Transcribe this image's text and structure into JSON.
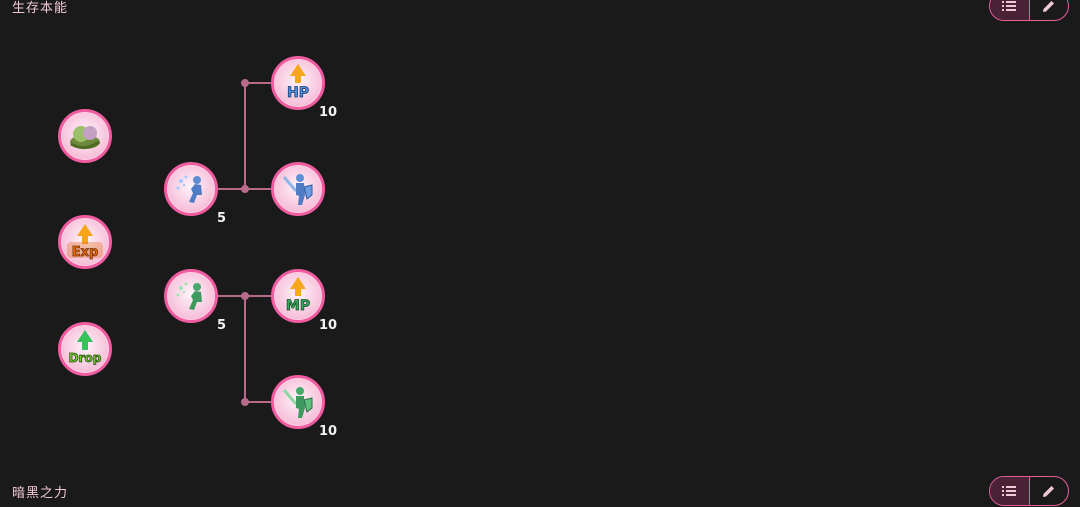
{
  "sections": [
    {
      "title": "生存本能"
    },
    {
      "title": "暗黑之力"
    }
  ],
  "toolbar": {
    "list_icon": "list-icon",
    "edit_icon": "pencil-icon"
  },
  "skills": {
    "clover": {
      "icon": "clover-icon"
    },
    "exp": {
      "icon": "exp-up-icon",
      "text": "Exp"
    },
    "drop": {
      "icon": "drop-up-icon",
      "text": "Drop"
    },
    "blue_rest": {
      "icon": "blue-rest-icon",
      "level": "5"
    },
    "hp_up": {
      "icon": "hp-up-icon",
      "text": "HP",
      "level": "10"
    },
    "blue_guard": {
      "icon": "blue-guard-icon"
    },
    "green_rest": {
      "icon": "green-rest-icon",
      "level": "5"
    },
    "mp_up": {
      "icon": "mp-up-icon",
      "text": "MP",
      "level": "10"
    },
    "green_guard": {
      "icon": "green-guard-icon",
      "level": "10"
    }
  },
  "colors": {
    "background": "#1b1a1b",
    "accent_pink": "#ef5c9f",
    "connector": "#b96a8b",
    "level_text": "#f2f2f2"
  }
}
